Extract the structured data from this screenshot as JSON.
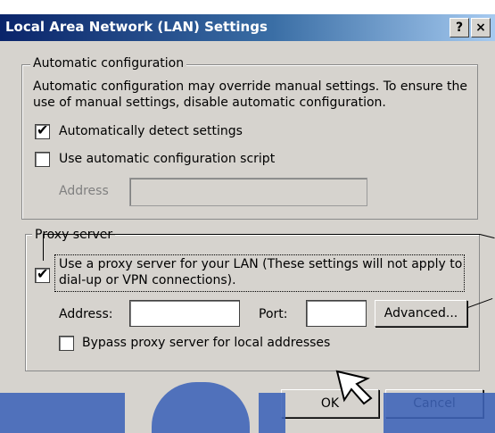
{
  "window": {
    "title": "Local Area Network (LAN) Settings",
    "help_glyph": "?",
    "close_glyph": "×"
  },
  "auto_config": {
    "legend": "Automatic configuration",
    "description_line1": "Automatic configuration may override manual settings.  To ensure the",
    "description_line2": "use of manual settings, disable automatic configuration.",
    "auto_detect_label": "Automatically detect settings",
    "auto_detect_checked": true,
    "use_script_label": "Use automatic configuration script",
    "use_script_checked": false,
    "address_label": "Address",
    "address_value": ""
  },
  "proxy": {
    "legend": "Proxy server",
    "use_proxy_label_line1": "Use a proxy server for your LAN (These settings will not apply to",
    "use_proxy_label_line2": "dial-up or VPN connections).",
    "use_proxy_checked": true,
    "address_label": "Address:",
    "address_value": "",
    "port_label": "Port:",
    "port_value": "",
    "advanced_label": "Advanced...",
    "bypass_label": "Bypass proxy server for local addresses",
    "bypass_checked": false
  },
  "footer": {
    "ok_label": "OK",
    "cancel_label": "Cancel"
  },
  "icons": {
    "check": "✔",
    "cursor": "mouse-pointer-icon"
  },
  "colors": {
    "title_start": "#0a246a",
    "title_end": "#a6caf0",
    "face": "#d6d3ce"
  }
}
